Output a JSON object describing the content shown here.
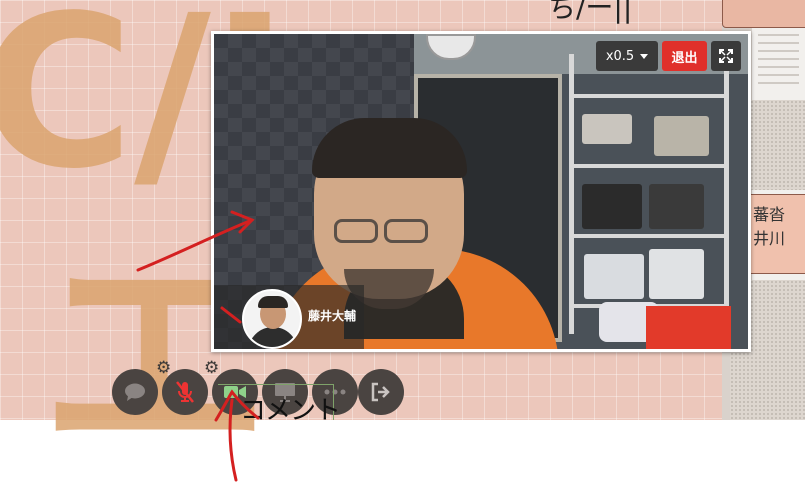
{
  "top_text": "ち/ー||",
  "board_chars": {
    "big_left": "C/L",
    "big_bottom": "エ"
  },
  "notes": {
    "right_note_line1": "蕃沓",
    "right_note_line2": "井川"
  },
  "video": {
    "speed_label": "x0.5",
    "exit_label": "退出",
    "participant_name": "藤井大輔"
  },
  "toolbar": {
    "buttons": [
      "chat",
      "mic-muted",
      "camera",
      "present",
      "more",
      "leave"
    ],
    "tooltip": "コメント"
  },
  "colors": {
    "exit": "#e0302a",
    "board": "#ecc7bb",
    "toolbar": "#4a4441",
    "annotation": "#d42020"
  }
}
